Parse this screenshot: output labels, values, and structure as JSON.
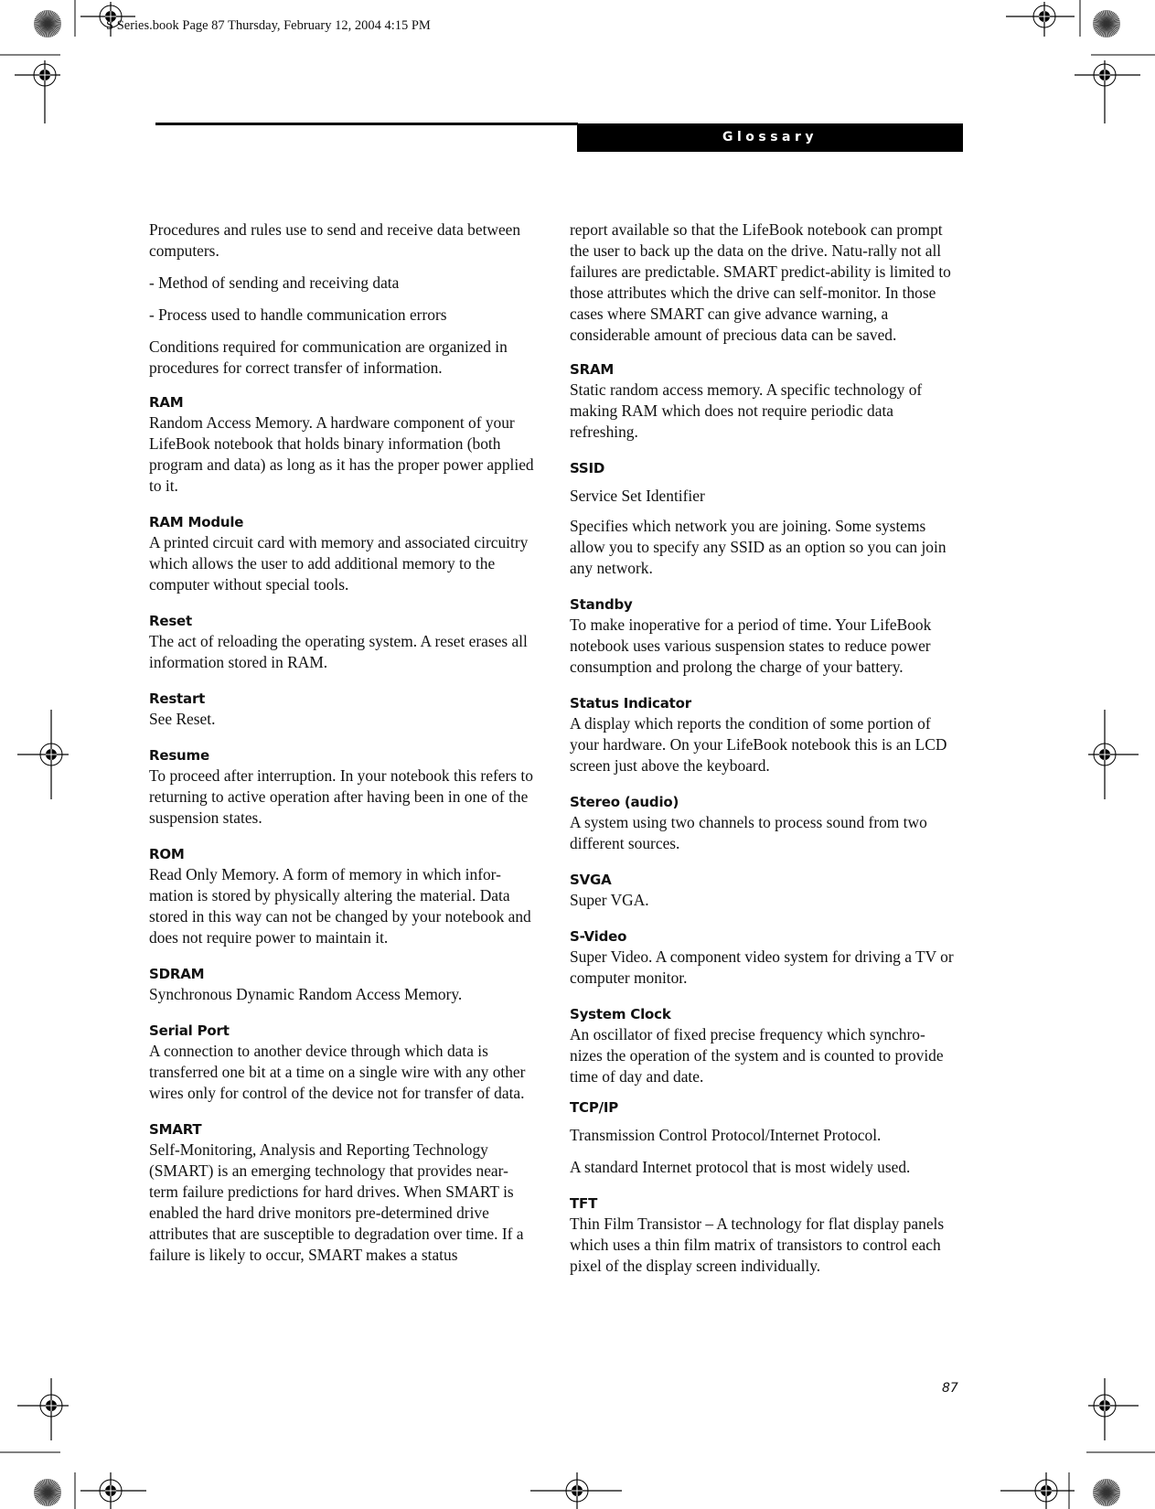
{
  "slug": "S Series.book  Page 87  Thursday, February 12, 2004  4:15 PM",
  "header": {
    "section_title": "Glossary"
  },
  "page_number": "87",
  "left_column": {
    "intro": [
      "Procedures and rules use to send and receive data between computers.",
      "- Method of sending and receiving data",
      "- Process used to handle communication errors",
      "Conditions required for communication are organized in procedures for correct transfer of information."
    ],
    "entries": [
      {
        "term": "RAM",
        "definition": "Random Access Memory. A hardware component of your LifeBook notebook that holds binary information (both program and data) as long as it has the proper power applied to it."
      },
      {
        "term": "RAM Module",
        "definition": "A printed circuit card with memory and associated circuitry which allows the user to add additional memory to the computer without special tools."
      },
      {
        "term": "Reset",
        "definition": "The act of reloading the operating system. A reset erases all information stored in RAM."
      },
      {
        "term": "Restart",
        "definition": "See Reset."
      },
      {
        "term": "Resume",
        "definition": "To proceed after interruption. In your notebook this refers to returning to active operation after having been in one of the suspension states."
      },
      {
        "term": "ROM",
        "definition": "Read Only Memory. A form of memory in which infor-mation is stored by physically altering the material. Data stored in this way can not be changed by your notebook and does not require power to maintain it."
      },
      {
        "term": "SDRAM",
        "definition": "Synchronous Dynamic Random Access Memory."
      },
      {
        "term": "Serial Port",
        "definition": "A connection to another device through which data is transferred one bit at a time on a single wire with any other wires only for control of the device not for transfer of data."
      },
      {
        "term": "SMART",
        "definition": "Self-Monitoring, Analysis and Reporting Technology (SMART) is an emerging technology that provides near-term failure predictions for hard drives. When SMART is enabled the hard drive monitors pre-determined drive attributes that are susceptible to degradation over time. If a failure is likely to occur, SMART makes a status"
      }
    ]
  },
  "right_column": {
    "continuation": "report available so that the LifeBook notebook can prompt the user to back up the data on the drive. Natu-rally not all failures are predictable. SMART predict-ability is limited to those attributes which the drive can self-monitor. In those cases where SMART can give advance warning, a considerable amount of precious data can be saved.",
    "entries": [
      {
        "term": "SRAM",
        "definition": "Static random access memory. A specific technology of making RAM which does not require periodic data refreshing."
      },
      {
        "term": "SSID",
        "definition": "Service Set Identifier",
        "definition_2": "Specifies which network you are joining. Some systems allow you to specify any SSID as an option so you can join any network."
      },
      {
        "term": "Standby",
        "definition": "To make inoperative for a period of time. Your LifeBook notebook uses various suspension states to reduce power consumption and prolong the charge of your battery."
      },
      {
        "term": "Status Indicator",
        "definition": "A display which reports the condition of some portion of your hardware. On your LifeBook notebook this is an LCD screen just above the keyboard."
      },
      {
        "term": "Stereo (audio)",
        "definition": "A system using two channels to process sound from two different sources."
      },
      {
        "term": "SVGA",
        "definition": "Super VGA."
      },
      {
        "term": "S-Video",
        "definition": "Super Video. A component video system for driving a TV or computer monitor."
      },
      {
        "term": "System Clock",
        "definition": "An oscillator of fixed precise frequency which synchro-nizes the operation of the system and is counted to provide time of day and date."
      },
      {
        "term": "TCP/IP",
        "definition": "Transmission Control Protocol/Internet Protocol.",
        "definition_2": "A standard Internet protocol that is most widely used."
      },
      {
        "term": "TFT",
        "definition": "Thin Film Transistor – A technology for flat display panels which uses a thin film matrix of transistors to control each pixel of the display screen individually."
      }
    ]
  }
}
